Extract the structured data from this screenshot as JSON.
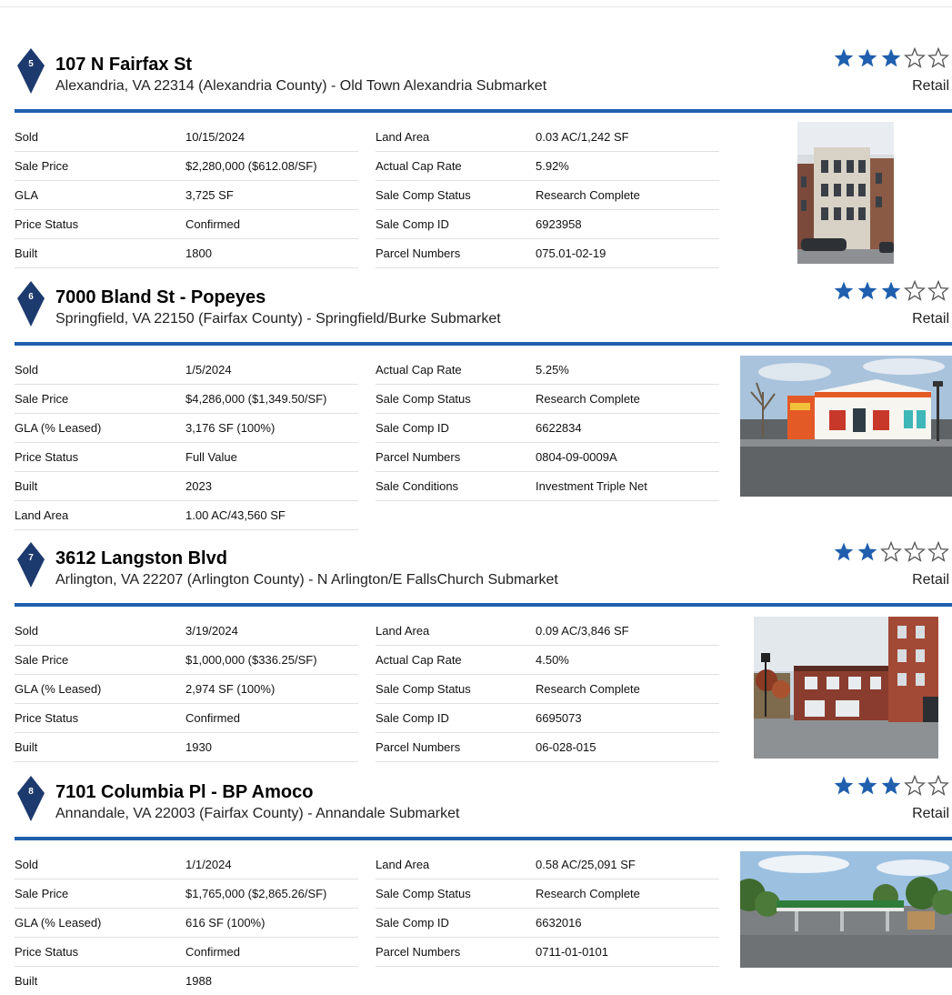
{
  "properties": [
    {
      "number": "5",
      "title": "107 N Fairfax St",
      "address": "Alexandria, VA 22314 (Alexandria County) - Old Town Alexandria Submarket",
      "rating": 3,
      "max_rating": 5,
      "type": "Retail",
      "left": [
        {
          "label": "Sold",
          "value": "10/15/2024"
        },
        {
          "label": "Sale Price",
          "value": "$2,280,000 ($612.08/SF)"
        },
        {
          "label": "GLA",
          "value": "3,725 SF"
        },
        {
          "label": "Price Status",
          "value": "Confirmed"
        },
        {
          "label": "Built",
          "value": "1800"
        }
      ],
      "right": [
        {
          "label": "Land Area",
          "value": "0.03 AC/1,242 SF"
        },
        {
          "label": "Actual Cap Rate",
          "value": "5.92%"
        },
        {
          "label": "Sale Comp Status",
          "value": "Research Complete"
        },
        {
          "label": "Sale Comp ID",
          "value": "6923958"
        },
        {
          "label": "Parcel Numbers",
          "value": "075.01-02-19"
        }
      ]
    },
    {
      "number": "6",
      "title": "7000 Bland St - Popeyes",
      "address": "Springfield, VA 22150 (Fairfax County) - Springfield/Burke Submarket",
      "rating": 3,
      "max_rating": 5,
      "type": "Retail",
      "left": [
        {
          "label": "Sold",
          "value": "1/5/2024"
        },
        {
          "label": "Sale Price",
          "value": "$4,286,000 ($1,349.50/SF)"
        },
        {
          "label": "GLA (% Leased)",
          "value": "3,176 SF (100%)"
        },
        {
          "label": "Price Status",
          "value": "Full Value"
        },
        {
          "label": "Built",
          "value": "2023"
        },
        {
          "label": "Land Area",
          "value": "1.00 AC/43,560 SF"
        }
      ],
      "right": [
        {
          "label": "Actual Cap Rate",
          "value": "5.25%"
        },
        {
          "label": "Sale Comp Status",
          "value": "Research Complete"
        },
        {
          "label": "Sale Comp ID",
          "value": "6622834"
        },
        {
          "label": "Parcel Numbers",
          "value": "0804-09-0009A"
        },
        {
          "label": "Sale Conditions",
          "value": "Investment Triple Net"
        }
      ]
    },
    {
      "number": "7",
      "title": "3612 Langston Blvd",
      "address": "Arlington, VA 22207 (Arlington County) - N Arlington/E FallsChurch Submarket",
      "rating": 2,
      "max_rating": 5,
      "type": "Retail",
      "left": [
        {
          "label": "Sold",
          "value": "3/19/2024"
        },
        {
          "label": "Sale Price",
          "value": "$1,000,000 ($336.25/SF)"
        },
        {
          "label": "GLA (% Leased)",
          "value": "2,974 SF (100%)"
        },
        {
          "label": "Price Status",
          "value": "Confirmed"
        },
        {
          "label": "Built",
          "value": "1930"
        }
      ],
      "right": [
        {
          "label": "Land Area",
          "value": "0.09 AC/3,846 SF"
        },
        {
          "label": "Actual Cap Rate",
          "value": "4.50%"
        },
        {
          "label": "Sale Comp Status",
          "value": "Research Complete"
        },
        {
          "label": "Sale Comp ID",
          "value": "6695073"
        },
        {
          "label": "Parcel Numbers",
          "value": "06-028-015"
        }
      ]
    },
    {
      "number": "8",
      "title": "7101 Columbia Pl - BP Amoco",
      "address": "Annandale, VA 22003 (Fairfax County) - Annandale Submarket",
      "rating": 3,
      "max_rating": 5,
      "type": "Retail",
      "left": [
        {
          "label": "Sold",
          "value": "1/1/2024"
        },
        {
          "label": "Sale Price",
          "value": "$1,765,000 ($2,865.26/SF)"
        },
        {
          "label": "GLA (% Leased)",
          "value": "616 SF (100%)"
        },
        {
          "label": "Price Status",
          "value": "Confirmed"
        },
        {
          "label": "Built",
          "value": "1988"
        }
      ],
      "right": [
        {
          "label": "Land Area",
          "value": "0.58 AC/25,091 SF"
        },
        {
          "label": "Sale Comp Status",
          "value": "Research Complete"
        },
        {
          "label": "Sale Comp ID",
          "value": "6632016"
        },
        {
          "label": "Parcel Numbers",
          "value": "0711-01-0101"
        }
      ]
    }
  ],
  "colors": {
    "accent": "#1f5fae",
    "marker": "#1d3a6e",
    "star_filled": "#1f5fae",
    "star_empty": "#555555"
  }
}
